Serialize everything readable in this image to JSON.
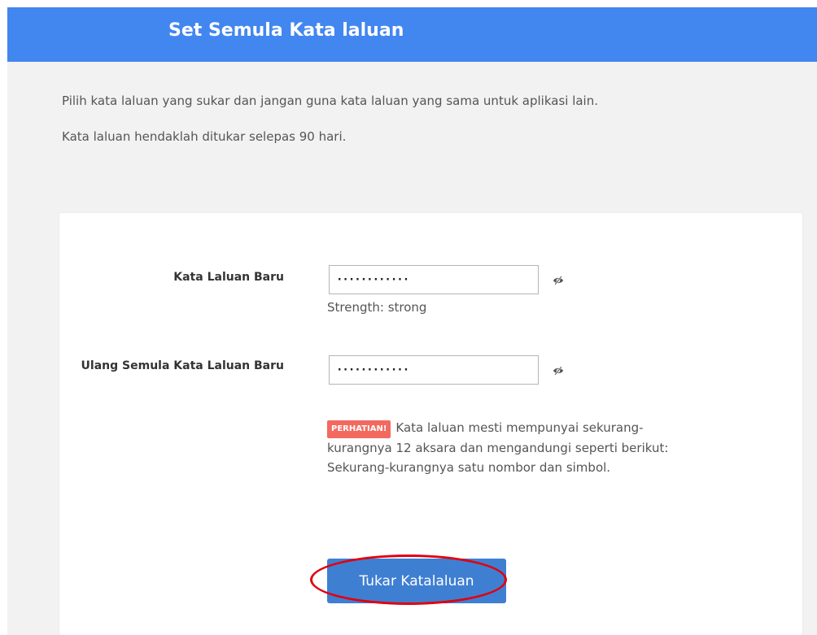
{
  "header": {
    "title": "Set Semula Kata laluan"
  },
  "intro": {
    "line1": "Pilih kata laluan yang sukar dan jangan guna kata laluan yang sama untuk aplikasi lain.",
    "line2": "Kata laluan hendaklah ditukar selepas 90 hari."
  },
  "form": {
    "new_password": {
      "label": "Kata Laluan Baru",
      "value": "············",
      "toggle_icon": "eye-slash-icon"
    },
    "strength": "Strength: strong",
    "confirm_password": {
      "label": "Ulang Semula Kata Laluan Baru",
      "value": "············",
      "toggle_icon": "eye-slash-icon"
    },
    "notice": {
      "badge": "PERHATIAN!",
      "text": "Kata laluan mesti mempunyai sekurang-kurangnya 12 aksara dan mengandungi seperti berikut: Sekurang-kurangnya satu nombor dan simbol."
    },
    "submit_label": "Tukar Katalaluan"
  },
  "colors": {
    "header_bg": "#4286f0",
    "page_bg": "#f2f2f2",
    "button_bg": "#3f7fd2",
    "badge_bg": "#f26a5f",
    "highlight_ring": "#e1000f"
  }
}
